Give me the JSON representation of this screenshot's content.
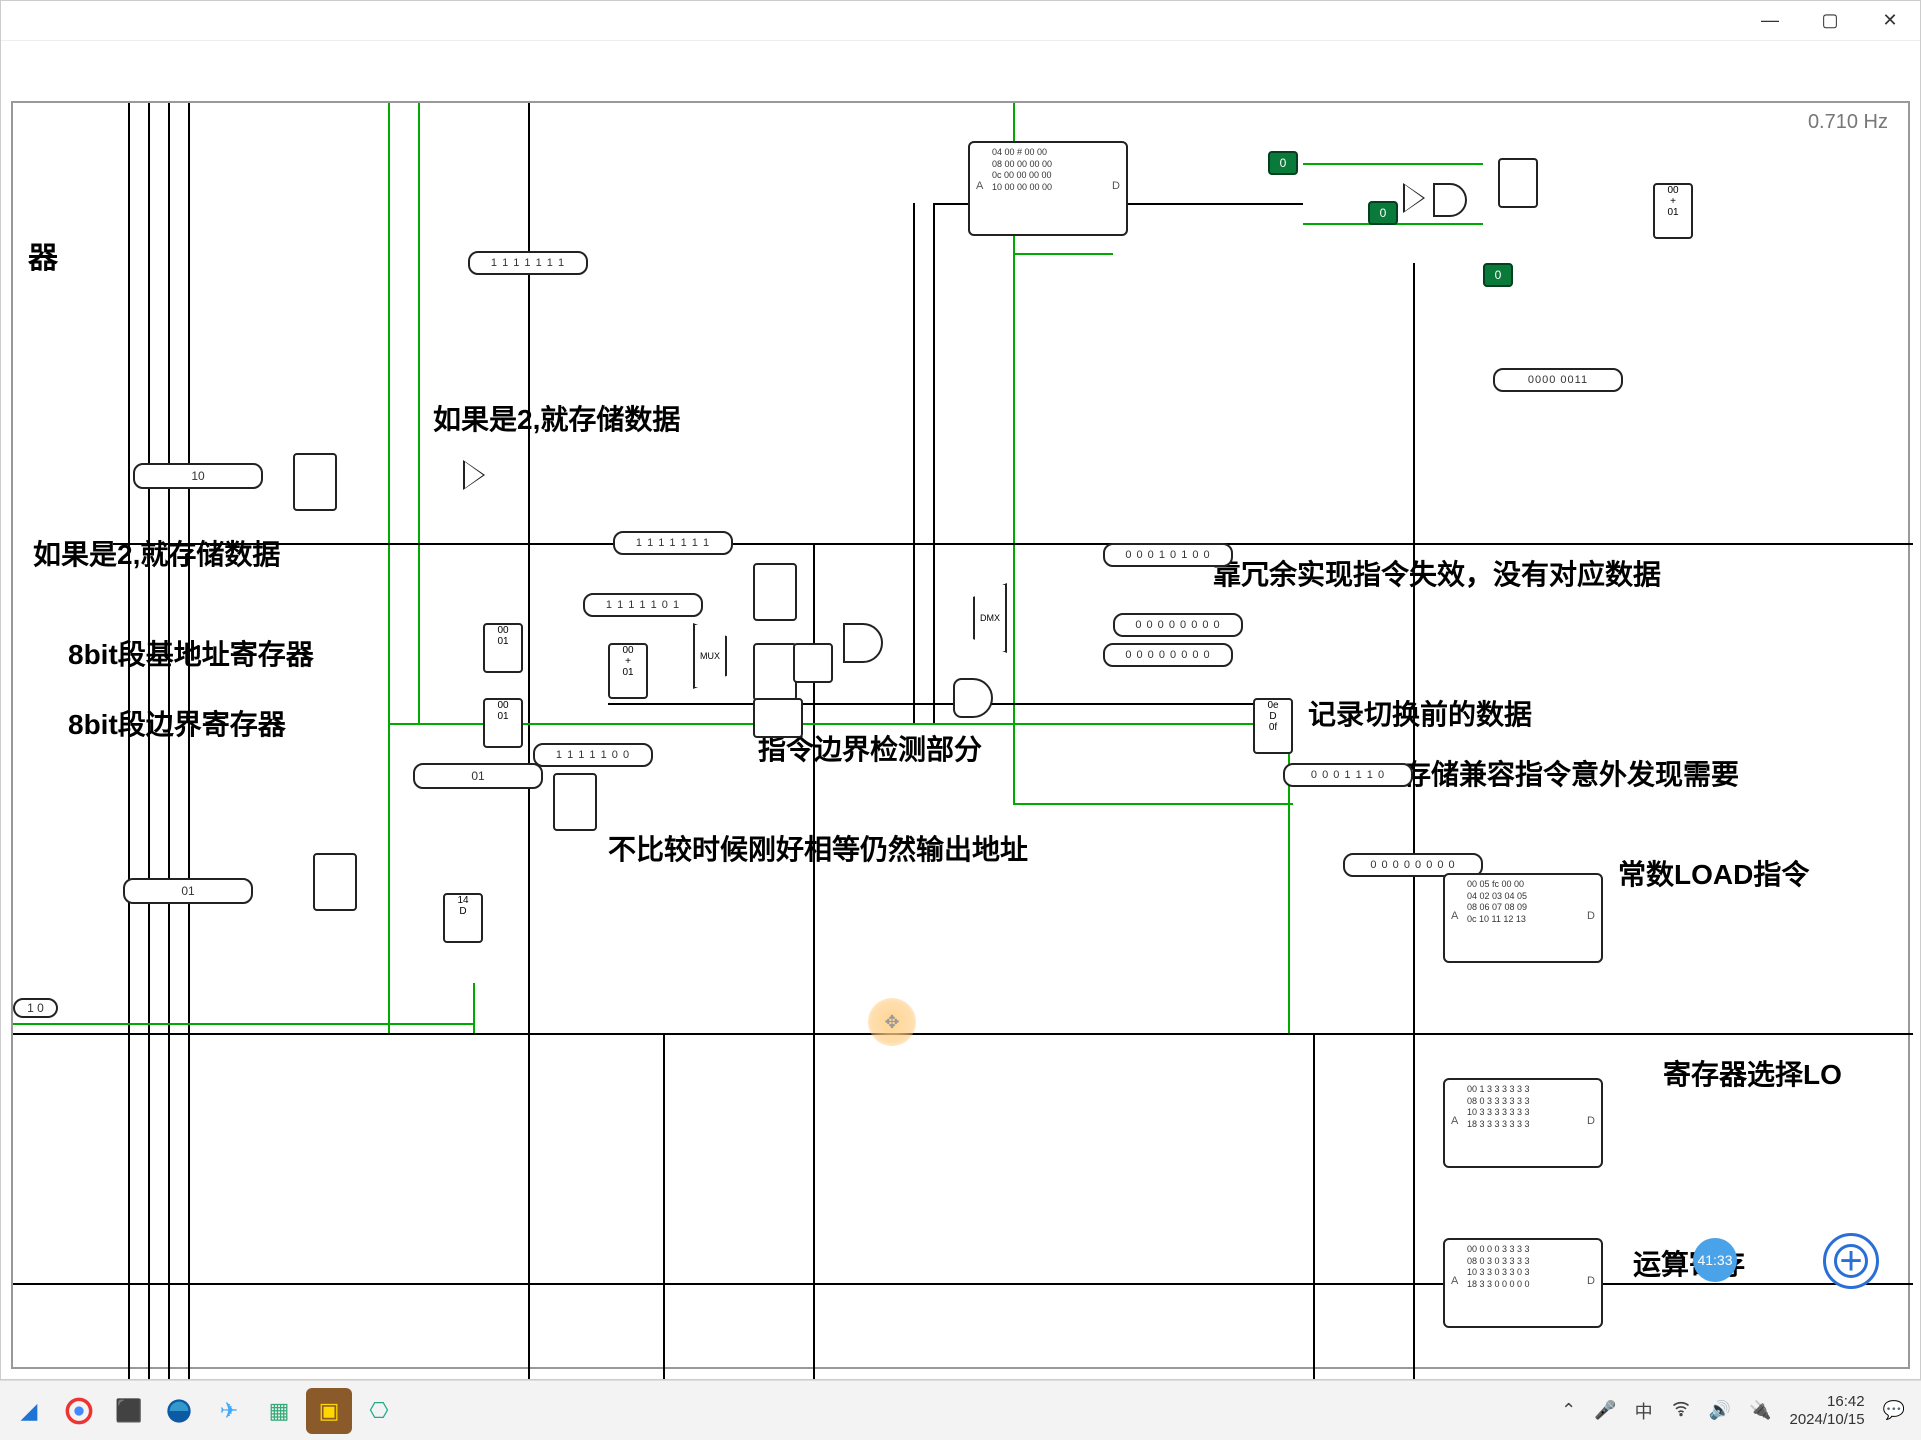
{
  "window": {
    "frequency": "0.710 Hz"
  },
  "labels": {
    "left_partial_top": "器",
    "store_if_2_a": "如果是2,就存储数据",
    "store_if_2_b": "如果是2,就存储数据",
    "base_addr_reg": "8bit段基地址寄存器",
    "bound_reg": "8bit段边界寄存器",
    "boundary_check": "指令边界检测部分",
    "no_compare_equal": "不比较时候刚好相等仍然输出地址",
    "redundant_invalid": "靠冗余实现指令失效，没有对应数据",
    "record_pre_switch": "记录切换前的数据",
    "store_compat": "存储兼容指令意外发现需要",
    "const_load": "常数LOAD指令",
    "reg_select_load": "寄存器选择LO",
    "alu_reg_select": "运算寄存"
  },
  "registers": {
    "r1": "1 1 1 1 1 1 1",
    "r2": "1 1 1 1 1 1 1",
    "r3": "1 1 1 1 1 0 1",
    "r4": "1 1 1 1 1 0 0",
    "r5": "0 0 0 1 0 1 0 0",
    "r6": "0 0 0 0 0 0 0 0",
    "r7": "0 0 0 0 0 0 0 0",
    "r8": "0 0 0 1 1 1 0",
    "r9": "0 0 0 0 0 0 0 0",
    "r10": "0000 0011"
  },
  "sliders": {
    "s1": "10",
    "s2": "01",
    "s3": "01",
    "s4": "1 0"
  },
  "small_boxes": {
    "sb1": "00\n01",
    "sb2": "00\n01",
    "sb3": "14\nD",
    "sb4": "00\n+\n01",
    "sb5": "0e\nD\n0f",
    "sb6": "00\n+\n01"
  },
  "consts": {
    "c1": "0",
    "c2": "0",
    "c3": "0"
  },
  "roms": {
    "mem1": {
      "row0": "04 00 # 00 00",
      "row1": "08 00 00 00 00",
      "row2": "0c 00 00 00 00",
      "row3": "10 00 00 00 00",
      "highlight": "#"
    },
    "mem2": {
      "row0": "00 05 fc 00 00",
      "row1": "04 02 03 04 05",
      "row2": "08 06 07 08 09",
      "row3": "0c 10 11 12 13"
    },
    "mem3": {
      "row0": "00 1 3 3 3 3 3 3",
      "row1": "08 0 3 3 3 3 3 3",
      "row2": "10 3 3 3 3 3 3 3",
      "row3": "18 3 3 3 3 3 3 3"
    },
    "mem4": {
      "row0": "00 0 0 0 3 3 3 3",
      "row1": "08 0 3 0 3 3 3 3",
      "row2": "10 3 3 0 3 3 0 3",
      "row3": "18 3 3 0 0 0 0 0"
    }
  },
  "mux_label": "MUX",
  "dmx_label": "DMX",
  "badge": "41:33",
  "taskbar": {
    "ime": "中",
    "time": "16:42",
    "date": "2024/10/15"
  }
}
